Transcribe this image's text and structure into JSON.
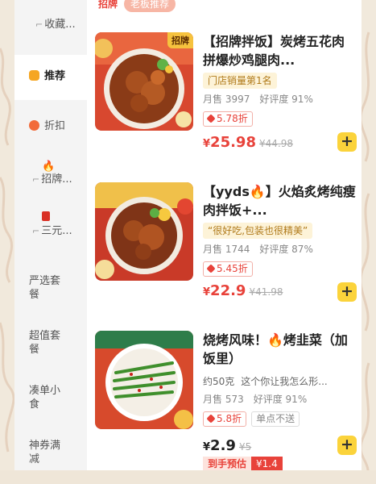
{
  "header": {
    "tag1": "招牌",
    "tag2": "老板推荐"
  },
  "sidebar": {
    "items": [
      {
        "label": "收藏..."
      },
      {
        "label": "推荐"
      },
      {
        "label": "折扣"
      },
      {
        "label": "招牌..."
      },
      {
        "label": "三元..."
      },
      {
        "label": "严选套餐"
      },
      {
        "label": "超值套餐"
      },
      {
        "label": "凑单小食"
      },
      {
        "label": "神券满减"
      }
    ]
  },
  "products": [
    {
      "badge": "招牌",
      "title": "【招牌拌饭】炭烤五花肉拼爆炒鸡腿肉...",
      "rank": "门店销量第1名",
      "sales": "月售 3997",
      "rating": "好评度 91%",
      "discount": "5.78折",
      "price": "25.98",
      "old_price": "¥44.98",
      "add": "+"
    },
    {
      "title": "【yyds🔥】火焰炙烤纯瘦肉拌饭+...",
      "quote": "“很好吃,包装也很精美”",
      "sales": "月售 1744",
      "rating": "好评度 87%",
      "discount": "5.45折",
      "price": "22.9",
      "old_price": "¥41.98",
      "add": "+"
    },
    {
      "title": "烧烤风味！🔥烤韭菜（加饭里）",
      "weight": "约50克",
      "desc": "这个你让我怎么形...",
      "sales": "月售 573",
      "rating": "好评度 91%",
      "discount": "5.8折",
      "no_delivery": "单点不送",
      "price": "2.9",
      "old_price": "¥5",
      "presale_label": "到手预估",
      "presale_price": "¥1.4",
      "add": "+"
    }
  ],
  "currency": "¥",
  "colors": {
    "accent": "#e8423a",
    "add_button": "#fbd33b",
    "rank_tag_bg": "#fdf3d8"
  },
  "icons": [
    "fire-icon",
    "tag-icon",
    "add-icon"
  ]
}
